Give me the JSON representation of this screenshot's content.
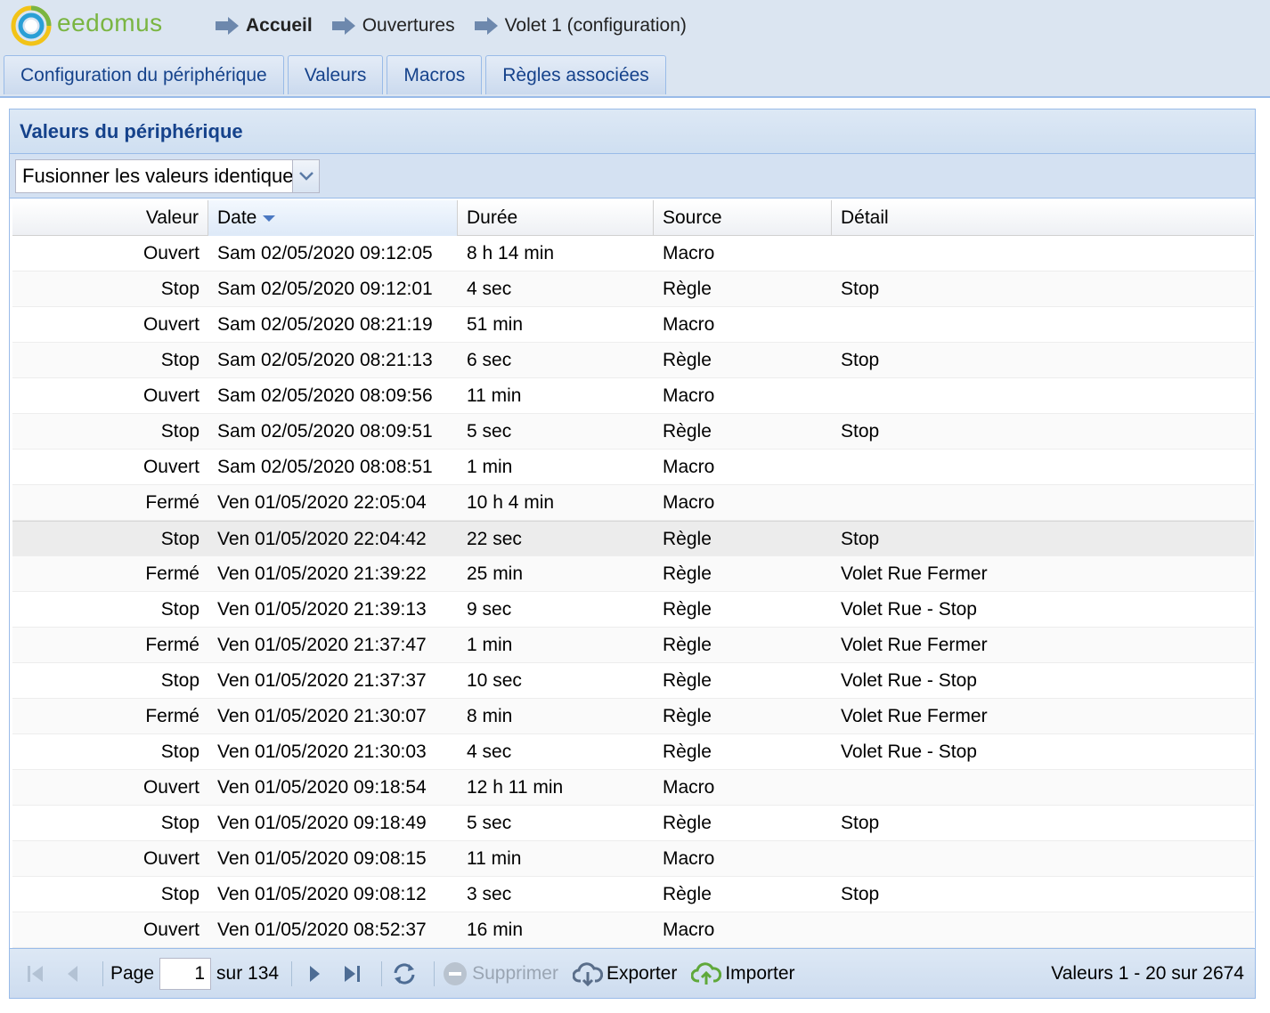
{
  "app": {
    "logo_text": "eedomus"
  },
  "breadcrumb": [
    {
      "label": "Accueil",
      "bold": true
    },
    {
      "label": "Ouvertures",
      "bold": false
    },
    {
      "label": "Volet 1 (configuration)",
      "bold": false
    }
  ],
  "tabs": [
    {
      "label": "Configuration du périphérique"
    },
    {
      "label": "Valeurs"
    },
    {
      "label": "Macros"
    },
    {
      "label": "Règles associées"
    }
  ],
  "panel": {
    "title": "Valeurs du périphérique",
    "filter_value": "Fusionner les valeurs identiques"
  },
  "grid": {
    "columns": {
      "valeur": "Valeur",
      "date": "Date",
      "duree": "Durée",
      "source": "Source",
      "detail": "Détail"
    },
    "rows": [
      {
        "valeur": "Ouvert",
        "date": "Sam 02/05/2020 09:12:05",
        "duree": "8 h 14 min",
        "source": "Macro",
        "detail": ""
      },
      {
        "valeur": "Stop",
        "date": "Sam 02/05/2020 09:12:01",
        "duree": "4 sec",
        "source": "Règle",
        "detail": "Stop"
      },
      {
        "valeur": "Ouvert",
        "date": "Sam 02/05/2020 08:21:19",
        "duree": "51 min",
        "source": "Macro",
        "detail": ""
      },
      {
        "valeur": "Stop",
        "date": "Sam 02/05/2020 08:21:13",
        "duree": "6 sec",
        "source": "Règle",
        "detail": "Stop"
      },
      {
        "valeur": "Ouvert",
        "date": "Sam 02/05/2020 08:09:56",
        "duree": "11 min",
        "source": "Macro",
        "detail": ""
      },
      {
        "valeur": "Stop",
        "date": "Sam 02/05/2020 08:09:51",
        "duree": "5 sec",
        "source": "Règle",
        "detail": "Stop"
      },
      {
        "valeur": "Ouvert",
        "date": "Sam 02/05/2020 08:08:51",
        "duree": "1 min",
        "source": "Macro",
        "detail": ""
      },
      {
        "valeur": "Fermé",
        "date": "Ven 01/05/2020 22:05:04",
        "duree": "10 h 4 min",
        "source": "Macro",
        "detail": ""
      },
      {
        "valeur": "Stop",
        "date": "Ven 01/05/2020 22:04:42",
        "duree": "22 sec",
        "source": "Règle",
        "detail": "Stop"
      },
      {
        "valeur": "Fermé",
        "date": "Ven 01/05/2020 21:39:22",
        "duree": "25 min",
        "source": "Règle",
        "detail": "Volet Rue Fermer"
      },
      {
        "valeur": "Stop",
        "date": "Ven 01/05/2020 21:39:13",
        "duree": "9 sec",
        "source": "Règle",
        "detail": "Volet Rue - Stop"
      },
      {
        "valeur": "Fermé",
        "date": "Ven 01/05/2020 21:37:47",
        "duree": "1 min",
        "source": "Règle",
        "detail": "Volet Rue Fermer"
      },
      {
        "valeur": "Stop",
        "date": "Ven 01/05/2020 21:37:37",
        "duree": "10 sec",
        "source": "Règle",
        "detail": "Volet Rue - Stop"
      },
      {
        "valeur": "Fermé",
        "date": "Ven 01/05/2020 21:30:07",
        "duree": "8 min",
        "source": "Règle",
        "detail": "Volet Rue Fermer"
      },
      {
        "valeur": "Stop",
        "date": "Ven 01/05/2020 21:30:03",
        "duree": "4 sec",
        "source": "Règle",
        "detail": "Volet Rue - Stop"
      },
      {
        "valeur": "Ouvert",
        "date": "Ven 01/05/2020 09:18:54",
        "duree": "12 h 11 min",
        "source": "Macro",
        "detail": ""
      },
      {
        "valeur": "Stop",
        "date": "Ven 01/05/2020 09:18:49",
        "duree": "5 sec",
        "source": "Règle",
        "detail": "Stop"
      },
      {
        "valeur": "Ouvert",
        "date": "Ven 01/05/2020 09:08:15",
        "duree": "11 min",
        "source": "Macro",
        "detail": ""
      },
      {
        "valeur": "Stop",
        "date": "Ven 01/05/2020 09:08:12",
        "duree": "3 sec",
        "source": "Règle",
        "detail": "Stop"
      },
      {
        "valeur": "Ouvert",
        "date": "Ven 01/05/2020 08:52:37",
        "duree": "16 min",
        "source": "Macro",
        "detail": ""
      }
    ],
    "selected_row": 8
  },
  "paging": {
    "page_label": "Page",
    "page_value": "1",
    "of_label": "sur 134",
    "delete_label": "Supprimer",
    "export_label": "Exporter",
    "import_label": "Importer",
    "info": "Valeurs 1 - 20 sur 2674"
  },
  "colors": {
    "header_bg": "#dbe5f1",
    "title_blue": "#15428b",
    "logo_green": "#7ab542",
    "logo_ring_blue": "#2a9fd6",
    "logo_ring_yellow": "#f2c318"
  }
}
